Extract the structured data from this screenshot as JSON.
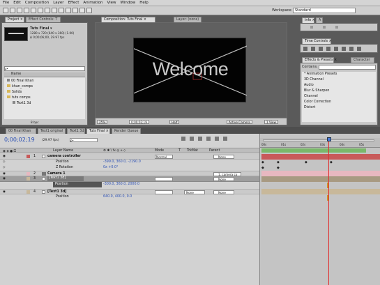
{
  "menu": [
    "File",
    "Edit",
    "Composition",
    "Layer",
    "Effect",
    "Animation",
    "View",
    "Window",
    "Help"
  ],
  "workspace": {
    "label": "Workspace:",
    "value": "Standard"
  },
  "project": {
    "tabs": [
      "Project ×",
      "Effect Controls: T"
    ],
    "comp_name": "Tuts Final ▾",
    "comp_info": [
      "1280 x 720 (640 x 360) (1.00)",
      "Δ 0;00;06;00, 29.97 fps"
    ],
    "search_placeholder": "ρ•",
    "column_name": "Name",
    "items": [
      "00 Final Khan",
      "khan_comps",
      "Solids",
      "tuts comps",
      "Text1 3d"
    ],
    "footer_bpc": "8 bpc"
  },
  "comp_viewer": {
    "tabs": [
      "Composition: Tuts Final ×",
      "Layer: (none)"
    ],
    "canvas_text": "Welcome",
    "footer": {
      "zoom": "25%",
      "timecode": "0;00;02;19",
      "resolution": "Half",
      "camera": "Active Camera",
      "view": "1 View"
    }
  },
  "info_panel": {
    "tab": "Info ×",
    "tab2": "A"
  },
  "time_controls": {
    "tab": "Time Controls ×"
  },
  "effects_presets": {
    "tabs": [
      "Effects & Presets ×",
      "Character"
    ],
    "search_label": "Contains:",
    "items": [
      "* Animation Presets",
      "3D Channel",
      "Audio",
      "Blur & Sharpen",
      "Channel",
      "Color Correction",
      "Distort"
    ]
  },
  "timeline_tabs": [
    "00 Final Khan",
    "Text1 original",
    "Text1 3d",
    "Tuts Final ×",
    "Render Queue"
  ],
  "timeline": {
    "timecode": "0;00;02;19",
    "fps": "(29.97 fps)",
    "search_placeholder": "ρ•",
    "columns": {
      "layer_name": "Layer Name",
      "mode": "Mode",
      "t": "T",
      "trkmat": "TrkMat",
      "parent": "Parent"
    },
    "layers": [
      {
        "num": "1",
        "name": "camera controller",
        "mode": "Normal",
        "parent": "None"
      },
      {
        "num": "",
        "name": "Position",
        "value": "-399.0, 360.0, -2190.0"
      },
      {
        "num": "",
        "name": "Z Rotation",
        "value": "0x +0.0°"
      },
      {
        "num": "2",
        "name": "Camera 1",
        "parent": "1. camera co"
      },
      {
        "num": "3",
        "name": "[Text1 3d]",
        "mode": "",
        "parent": "None"
      },
      {
        "num": "",
        "name": "Position",
        "value": "-300.0, 360.0, 2000.0"
      },
      {
        "num": "4",
        "name": "[Text1 3d]",
        "mode": "",
        "trkmat": "None",
        "parent": "None"
      },
      {
        "num": "",
        "name": "Position",
        "value": "640.0, 400.0, 0.0"
      }
    ],
    "ruler_ticks": [
      "00s",
      "01s",
      "02s",
      "03s",
      "04s",
      "05s"
    ]
  },
  "colors": {
    "accent_blue": "#2a4fb5",
    "playhead": "#e03030",
    "layer_red": "#c85a5a",
    "layer_pink": "#e8b8c0",
    "layer_tan": "#c8b89a",
    "work_area_green": "#7ab86a"
  }
}
